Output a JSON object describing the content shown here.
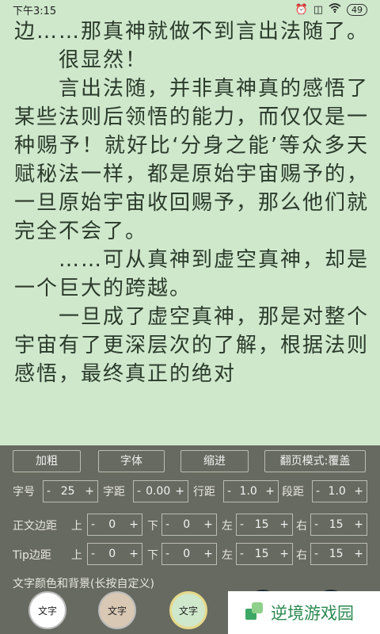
{
  "status": {
    "time": "下午3:15",
    "battery": "49"
  },
  "text": {
    "p1": "边……那真神就做不到言出法随了。",
    "p2": "很显然！",
    "p3": "言出法随，并非真神真的感悟了某些法则后领悟的能力，而仅仅是一种赐予！就好比‘分身之能’等众多天赋秘法一样，都是原始宇宙赐予的，一旦原始宇宙收回赐予，那么他们就完全不会了。",
    "p4": "……可从真神到虚空真神，却是一个巨大的跨越。",
    "p5": "一旦成了虚空真神，那是对整个宇宙有了更深层次的了解，根据法则感悟，最终真正的绝对"
  },
  "panel": {
    "buttons": [
      "加粗",
      "字体",
      "缩进",
      "翻页模式:覆盖"
    ],
    "row1": {
      "size_label": "字号",
      "size_value": "25",
      "spacing_label": "字距",
      "spacing_value": "0.00",
      "line_label": "行距",
      "line_value": "1.0",
      "para_label": "段距",
      "para_value": "1.0"
    },
    "row2": {
      "label": "正文边距",
      "top_label": "上",
      "top_value": "0",
      "bottom_label": "下",
      "bottom_value": "0",
      "left_label": "左",
      "left_value": "15",
      "right_label": "右",
      "right_value": "15"
    },
    "row3": {
      "label": "Tip边距",
      "top_label": "上",
      "top_value": "0",
      "bottom_label": "下",
      "bottom_value": "0",
      "left_label": "左",
      "left_value": "15",
      "right_label": "右",
      "right_value": "15"
    },
    "color_title": "文字颜色和背景(长按自定义)",
    "swatches": [
      {
        "label": "文字",
        "bg": "#ffffff",
        "fg": "#222222"
      },
      {
        "label": "文字",
        "bg": "#d8c8b4",
        "fg": "#222222"
      },
      {
        "label": "文字",
        "bg": "#cfe8cc",
        "fg": "#222222"
      }
    ],
    "minus": "-",
    "plus": "+"
  },
  "watermark": {
    "text": "逆境游戏园",
    "color": "#2c8a52"
  }
}
